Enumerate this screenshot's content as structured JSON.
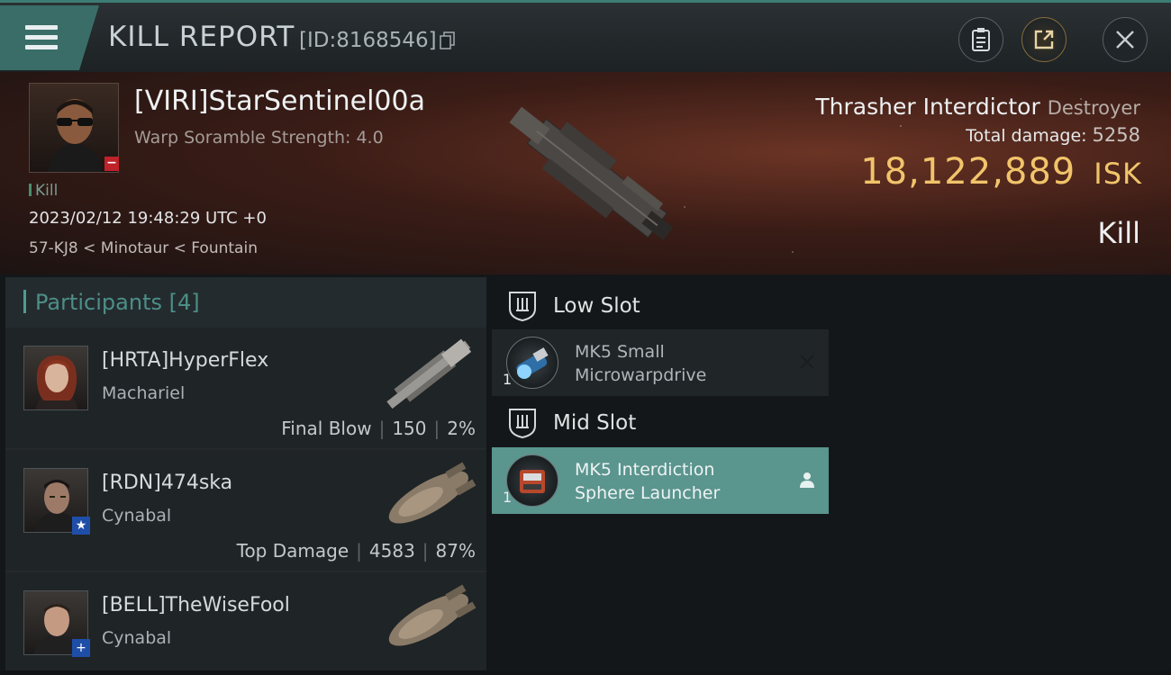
{
  "header": {
    "title": "KILL REPORT",
    "report_id": "[ID:8168546]"
  },
  "victim": {
    "name": "[VIRI]StarSentinel00a",
    "sub": "Warp Soramble Strength: 4.0",
    "tag": "Kill",
    "time": "2023/02/12 19:48:29 UTC +0",
    "location": "57-KJ8 < Minotaur < Fountain",
    "ship_name": "Thrasher Interdictor",
    "ship_class": "Destroyer",
    "total_damage_label": "Total damage:",
    "total_damage": "5258",
    "isk_value": "18,122,889",
    "isk_unit": "ISK",
    "outcome": "Kill"
  },
  "participants": {
    "title": "Participants",
    "count": "[4]",
    "rows": [
      {
        "name": "[HRTA]HyperFlex",
        "ship": "Machariel",
        "stat_label": "Final Blow",
        "damage": "150",
        "percent": "2%"
      },
      {
        "name": "[RDN]474ska",
        "ship": "Cynabal",
        "stat_label": "Top Damage",
        "damage": "4583",
        "percent": "87%"
      },
      {
        "name": "[BELL]TheWiseFool",
        "ship": "Cynabal",
        "stat_label": "",
        "damage": "",
        "percent": ""
      }
    ]
  },
  "slots": {
    "low": {
      "label": "Low Slot",
      "item": {
        "qty": "1",
        "line1": "MK5 Small",
        "line2": "Microwarpdrive",
        "status_icon": "destroyed-x-icon"
      }
    },
    "mid": {
      "label": "Mid Slot",
      "item": {
        "qty": "1",
        "line1": "MK5 Interdiction",
        "line2": "Sphere Launcher",
        "status_icon": "person-icon"
      }
    }
  },
  "colors": {
    "accent": "#4c9c94",
    "isk": "#f1c46a",
    "active_slot": "#5a958e",
    "victim_badge": "#c0222a"
  }
}
